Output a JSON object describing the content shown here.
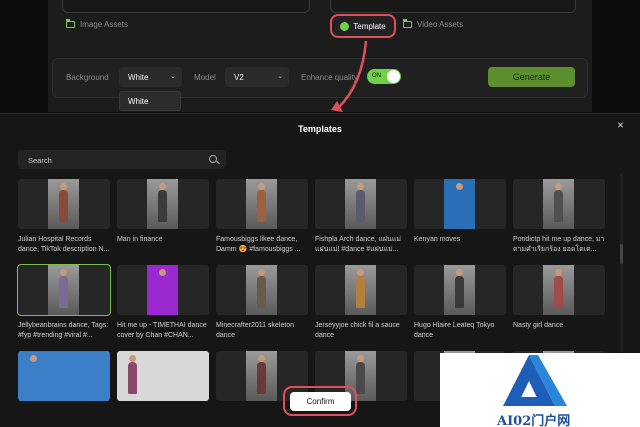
{
  "assets": {
    "image_label": "Image Assets",
    "template_label": "Template",
    "video_label": "Video Assets"
  },
  "controls": {
    "background_label": "Background",
    "background_value": "White",
    "dropdown_option": "White",
    "model_label": "Model",
    "model_value": "V2",
    "enhance_label": "Enhance quality",
    "toggle_label": "ON",
    "generate_label": "Generate"
  },
  "modal": {
    "title": "Templates",
    "close": "×",
    "search_placeholder": "Search",
    "confirm_label": "Confirm",
    "templates": [
      {
        "caption": "Julian Hospital Records dance, TikTok description N...",
        "color": "#8a4a3a"
      },
      {
        "caption": "Man in finance",
        "color": "#3b3b3b"
      },
      {
        "caption": "Famousbiggs likee dance, Damm 😍 #famousbiggs ...",
        "color": "#a06040"
      },
      {
        "caption": "Fishpla Arch dance, แฝนแม่ แฝนแม่! #dance #แฝนแม่...",
        "color": "#5a5a70"
      },
      {
        "caption": "Kenyan moves",
        "color": "#2a6fb5"
      },
      {
        "caption": "Pondictp hit me up dance, มาตามคำเรียกร้อง ยอดโตเต...",
        "color": "#505050"
      },
      {
        "caption": "Jellybeanbrains dance, Tags: #fyp #trending #viral #...",
        "color": "#7a6a9a"
      },
      {
        "caption": "Hit me up - TIMETHAI dance cover by Chan #CHAN...",
        "color": "#9a2ad0"
      },
      {
        "caption": "Minecrafter2011 skeleton dance",
        "color": "#6a5a4a"
      },
      {
        "caption": "Jerseyyjoe chick fil a sauce dance",
        "color": "#b08040"
      },
      {
        "caption": "Hugo Hiaire Leateq Tokyo dance",
        "color": "#3a3a3a"
      },
      {
        "caption": "Nasty girl dance",
        "color": "#a04a4a"
      },
      {
        "caption": "",
        "color": "#3a7fc8"
      },
      {
        "caption": "",
        "color": "#8a4a6a"
      },
      {
        "caption": "",
        "color": "#6a3a3a"
      },
      {
        "caption": "",
        "color": "#4a4a4a"
      },
      {
        "caption": "",
        "color": "#8a6a5a"
      },
      {
        "caption": "",
        "color": "#5a5a5a"
      }
    ]
  },
  "watermark": {
    "text": "AI02门户网"
  },
  "colors": {
    "accent": "#6fd14a",
    "highlight": "#e0505a"
  }
}
